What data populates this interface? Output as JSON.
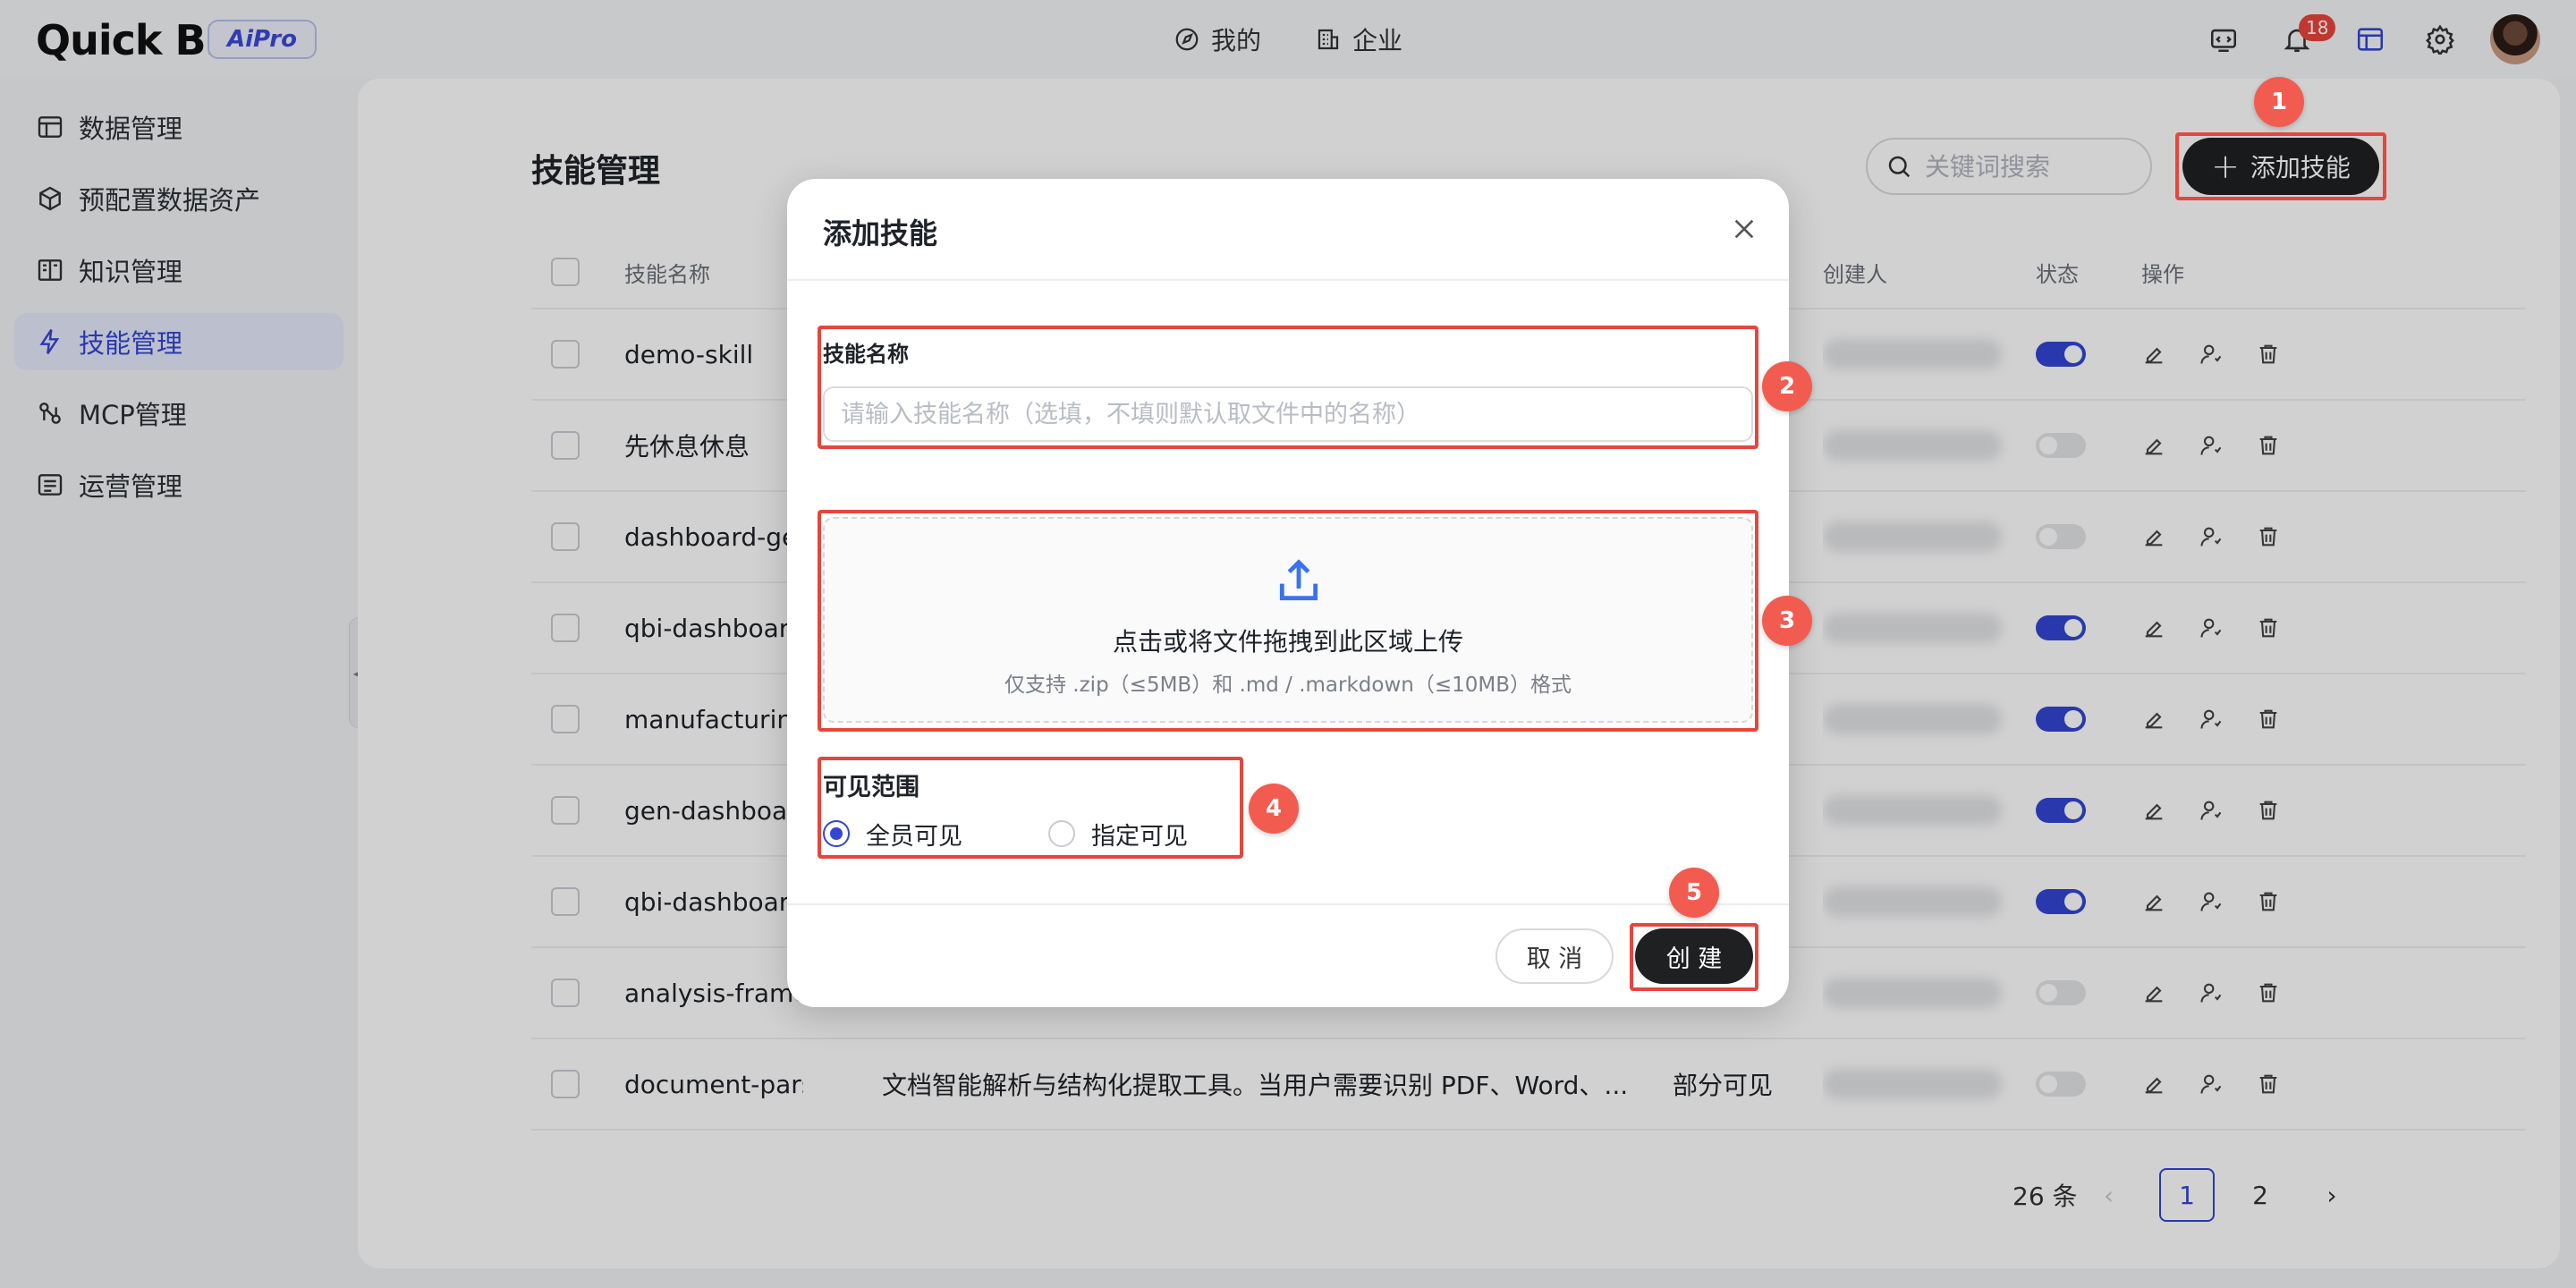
{
  "app": {
    "logo": "Quick BI",
    "badge": "AiPro"
  },
  "topnav": {
    "mine": "我的",
    "enterprise": "企业"
  },
  "notifications": {
    "count": "18"
  },
  "sidebar": {
    "items": [
      {
        "label": "数据管理",
        "icon": "table-icon"
      },
      {
        "label": "预配置数据资产",
        "icon": "cube-icon"
      },
      {
        "label": "知识管理",
        "icon": "book-icon"
      },
      {
        "label": "技能管理",
        "icon": "lightning-icon",
        "active": true
      },
      {
        "label": "MCP管理",
        "icon": "plugin-icon"
      },
      {
        "label": "运营管理",
        "icon": "list-icon"
      }
    ]
  },
  "page": {
    "title": "技能管理",
    "search_placeholder": "关键词搜索",
    "add_button": "添加技能"
  },
  "table": {
    "headers": {
      "name": "技能名称",
      "creator": "创建人",
      "status": "状态",
      "ops": "操作"
    },
    "rows": [
      {
        "name": "demo-skill",
        "desc": "",
        "visibility": "",
        "status": "on"
      },
      {
        "name": "先休息休息",
        "desc": "",
        "visibility": "",
        "status": "off"
      },
      {
        "name": "dashboard-ge",
        "desc": "",
        "visibility": "",
        "status": "off"
      },
      {
        "name": "qbi-dashboard",
        "desc": "",
        "visibility": "",
        "status": "on"
      },
      {
        "name": "manufacturing",
        "desc": "",
        "visibility": "",
        "status": "on"
      },
      {
        "name": "gen-dashboar",
        "desc": "",
        "visibility": "",
        "status": "on"
      },
      {
        "name": "qbi-dashboard",
        "desc": "",
        "visibility": "",
        "status": "on"
      },
      {
        "name": "analysis-frame",
        "desc": "",
        "visibility": "",
        "status": "off"
      },
      {
        "name": "document-parser",
        "desc": "文档智能解析与结构化提取工具。当用户需要识别 PDF、Word、...",
        "visibility": "部分可见",
        "status": "off"
      }
    ]
  },
  "pagination": {
    "total": "26 条",
    "pages": [
      "1",
      "2"
    ],
    "current": "1"
  },
  "modal": {
    "title": "添加技能",
    "name_label": "技能名称",
    "name_placeholder": "请输入技能名称（选填，不填则默认取文件中的名称）",
    "upload_main": "点击或将文件拖拽到此区域上传",
    "upload_hint": "仅支持 .zip（≤5MB）和 .md / .markdown（≤10MB）格式",
    "visibility_label": "可见范围",
    "options": {
      "all": "全员可见",
      "specified": "指定可见"
    },
    "selected": "all",
    "cancel": "取 消",
    "create": "创 建"
  },
  "annotations": [
    "1",
    "2",
    "3",
    "4",
    "5"
  ],
  "colors": {
    "accent": "#3246d3",
    "primary_button": "#1f2022",
    "highlight": "#e8453c"
  }
}
